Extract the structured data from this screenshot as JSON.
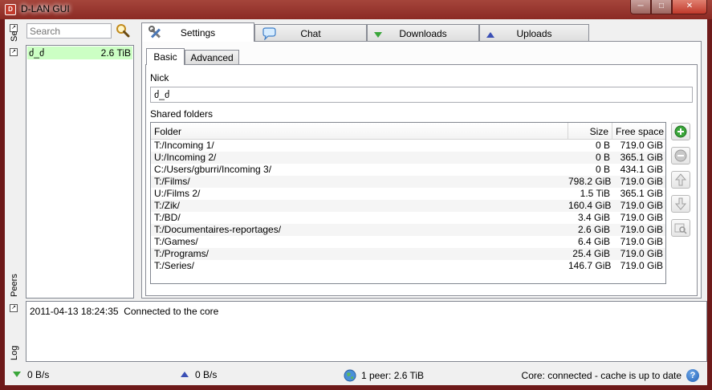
{
  "window": {
    "title": "D-LAN GUI",
    "icon_text": "D"
  },
  "left_panels": {
    "search_label": "Search",
    "peers_label": "Peers",
    "log_label": "Log"
  },
  "search": {
    "placeholder": "Search"
  },
  "peers": [
    {
      "name": "ძ_ძ",
      "size": "2.6 TiB"
    }
  ],
  "tabs": [
    {
      "label": "Settings",
      "icon": "tools-icon",
      "active": true
    },
    {
      "label": "Chat",
      "icon": "speech-bubble-icon"
    },
    {
      "label": "Downloads",
      "icon": "down-arrow-icon"
    },
    {
      "label": "Uploads",
      "icon": "up-arrow-icon"
    }
  ],
  "subtabs": [
    {
      "label": "Basic",
      "active": true
    },
    {
      "label": "Advanced"
    }
  ],
  "settings": {
    "nick_label": "Nick",
    "nick_value": "ძ_ძ",
    "shared_label": "Shared folders",
    "columns": [
      "Folder",
      "Size",
      "Free space"
    ],
    "folders": [
      [
        "T:/Incoming 1/",
        "0 B",
        "719.0 GiB"
      ],
      [
        "U:/Incoming 2/",
        "0 B",
        "365.1 GiB"
      ],
      [
        "C:/Users/gburri/Incoming 3/",
        "0 B",
        "434.1 GiB"
      ],
      [
        "T:/Films/",
        "798.2 GiB",
        "719.0 GiB"
      ],
      [
        "U:/Films 2/",
        "1.5 TiB",
        "365.1 GiB"
      ],
      [
        "T:/Zik/",
        "160.4 GiB",
        "719.0 GiB"
      ],
      [
        "T:/BD/",
        "3.4 GiB",
        "719.0 GiB"
      ],
      [
        "T:/Documentaires-reportages/",
        "2.6 GiB",
        "719.0 GiB"
      ],
      [
        "T:/Games/",
        "6.4 GiB",
        "719.0 GiB"
      ],
      [
        "T:/Programs/",
        "25.4 GiB",
        "719.0 GiB"
      ],
      [
        "T:/Series/",
        "146.7 GiB",
        "719.0 GiB"
      ]
    ],
    "side_buttons": [
      "add-folder",
      "remove-folder",
      "move-up",
      "move-down",
      "browse-folder"
    ]
  },
  "log": {
    "timestamp": "2011-04-13 18:24:35",
    "message": "Connected to the core"
  },
  "status": {
    "download_rate": "0 B/s",
    "upload_rate": "0 B/s",
    "peers_summary": "1 peer: 2.6 TiB",
    "core_status": "Core: connected - cache is up to date"
  },
  "colors": {
    "title_bar": "#8b2a24",
    "peer_highlight": "#ccffc4",
    "add_button": "#3aa63a",
    "down_arrow": "#3aa63a",
    "up_arrow": "#3a4fb5"
  }
}
